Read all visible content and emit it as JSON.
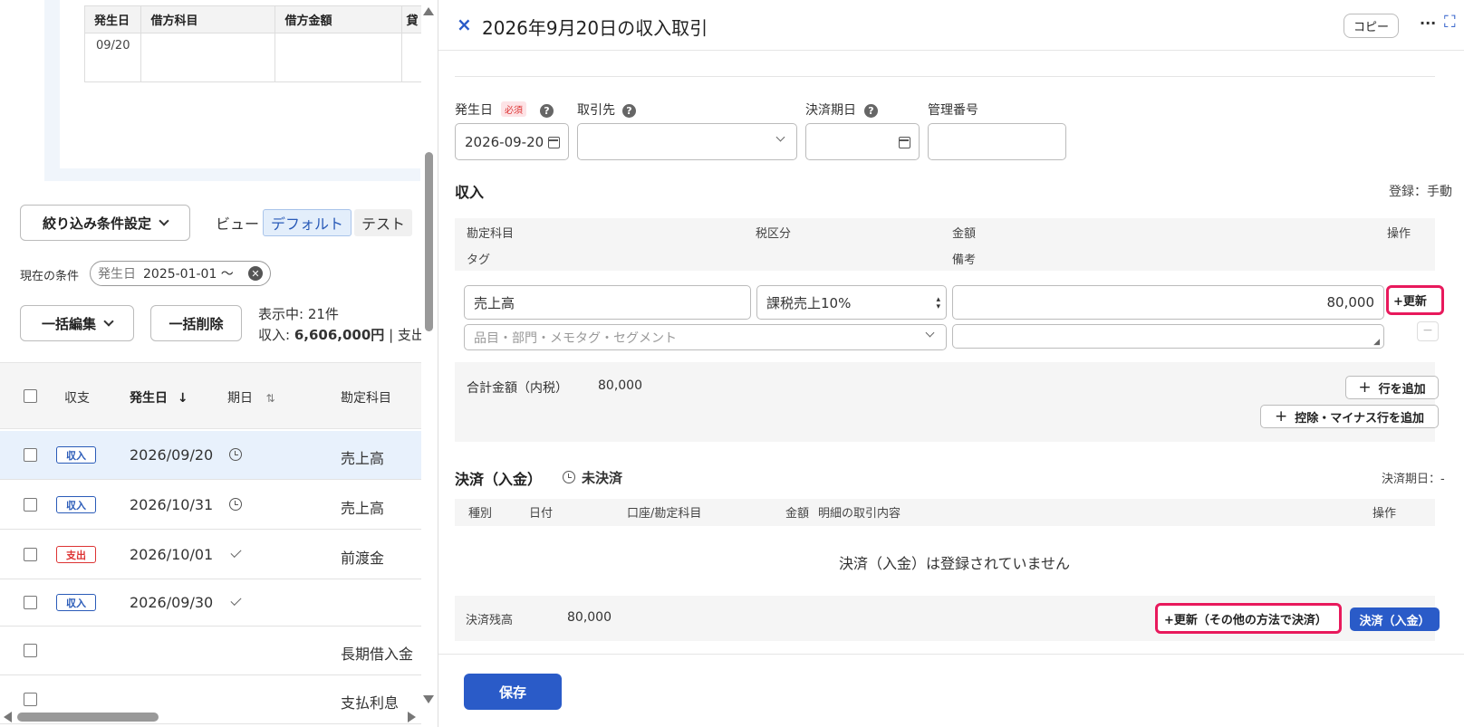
{
  "journal": {
    "headers": [
      "発生日",
      "借方科目",
      "借方金額",
      "貸"
    ],
    "row_date": "09/20"
  },
  "filters": {
    "filter_button": "絞り込み条件設定",
    "view_label": "ビュー",
    "view_tabs": [
      "デフォルト",
      "テスト"
    ],
    "current_label": "現在の条件",
    "chip_key": "発生日",
    "chip_value": "2025-01-01 〜"
  },
  "actions": {
    "bulk_edit": "一括編集",
    "bulk_delete": "一括削除",
    "showing": "表示中: 21件",
    "income_summary": "収入: ",
    "income_amount": "6,606,000円",
    "expense_summary": " | 支出:"
  },
  "list": {
    "headers": {
      "type": "収支",
      "date": "発生日",
      "due": "期日",
      "account": "勘定科目"
    },
    "rows": [
      {
        "type": "収入",
        "kind": "in",
        "date": "2026/09/20",
        "due": "clock",
        "account": "売上高",
        "selected": true
      },
      {
        "type": "収入",
        "kind": "in",
        "date": "2026/10/31",
        "due": "clock",
        "account": "売上高"
      },
      {
        "type": "支出",
        "kind": "out",
        "date": "2026/10/01",
        "due": "check",
        "account": "前渡金"
      },
      {
        "type": "収入",
        "kind": "in",
        "date": "2026/09/30",
        "due": "check",
        "account": ""
      },
      {
        "type": "",
        "kind": "",
        "date": "",
        "due": "",
        "account": "長期借入金"
      },
      {
        "type": "",
        "kind": "",
        "date": "",
        "due": "",
        "account": "支払利息"
      }
    ]
  },
  "panel": {
    "close_icon": "×",
    "title": "2026年9月20日の収入取引",
    "copy_button": "コピー",
    "more_icon": "···",
    "expand_icon": "⛶",
    "fields": {
      "issue_date_label": "発生日",
      "required_badge": "必須",
      "issue_date_value": "2026-09-20",
      "partner_label": "取引先",
      "due_label": "決済期日",
      "mgmt_label": "管理番号"
    },
    "income": {
      "title": "収入",
      "registration": "登録：手動",
      "col_account": "勘定科目",
      "col_tax": "税区分",
      "col_amount": "金額",
      "col_ops": "操作",
      "col_tag": "タグ",
      "col_note": "備考",
      "account_value": "売上高",
      "tax_value": "課税売上10%",
      "amount_value": "80,000",
      "update_button": "+更新",
      "tag_placeholder": "品目・部門・メモタグ・セグメント",
      "total_label": "合計金額（内税）",
      "total_value": "80,000",
      "add_row": "行を追加",
      "add_deduction_row": "控除・マイナス行を追加"
    },
    "settlement": {
      "title": "決済（入金）",
      "status": "未決済",
      "due_label": "決済期日：-",
      "col_kind": "種別",
      "col_date": "日付",
      "col_account": "口座/勘定科目",
      "col_amount": "金額",
      "col_detail": "明細の取引内容",
      "col_ops": "操作",
      "empty_message": "決済（入金）は登録されていません",
      "balance_label": "決済残高",
      "balance_value": "80,000",
      "update_other": "+更新（その他の方法で決済）",
      "settle_button": "決済（入金）"
    },
    "save_button": "保存"
  },
  "colors": {
    "accent": "#2a5bc8",
    "highlight": "#e8195c",
    "income_badge": "#2a5bb8",
    "expense_badge": "#dd3333"
  }
}
